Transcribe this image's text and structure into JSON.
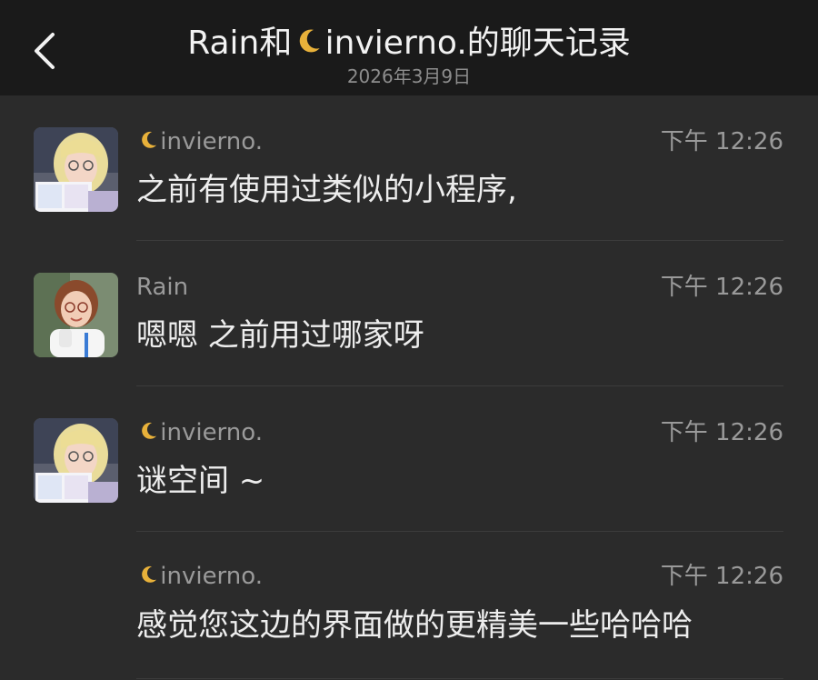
{
  "header": {
    "title_prefix": "Rain和",
    "title_suffix": "invierno.的聊天记录",
    "date": "2026年3月9日"
  },
  "messages": [
    {
      "sender": "invierno.",
      "sender_has_moon": true,
      "time": "下午 12:26",
      "text": "之前有使用过类似的小程序,",
      "avatar": "avatar-blonde-girl-reading"
    },
    {
      "sender": "Rain",
      "sender_has_moon": false,
      "time": "下午 12:26",
      "text": "嗯嗯 之前用过哪家呀",
      "avatar": "avatar-woman-glasses"
    },
    {
      "sender": "invierno.",
      "sender_has_moon": true,
      "time": "下午 12:26",
      "text": "谜空间 ~",
      "avatar": "avatar-blonde-girl-reading"
    },
    {
      "sender": "invierno.",
      "sender_has_moon": true,
      "time": "下午 12:26",
      "text": "感觉您这边的界面做的更精美一些哈哈哈",
      "avatar": ""
    }
  ],
  "colors": {
    "header_bg": "#1a1a1a",
    "page_bg": "#2b2b2b",
    "moon": "#e8b13a"
  }
}
